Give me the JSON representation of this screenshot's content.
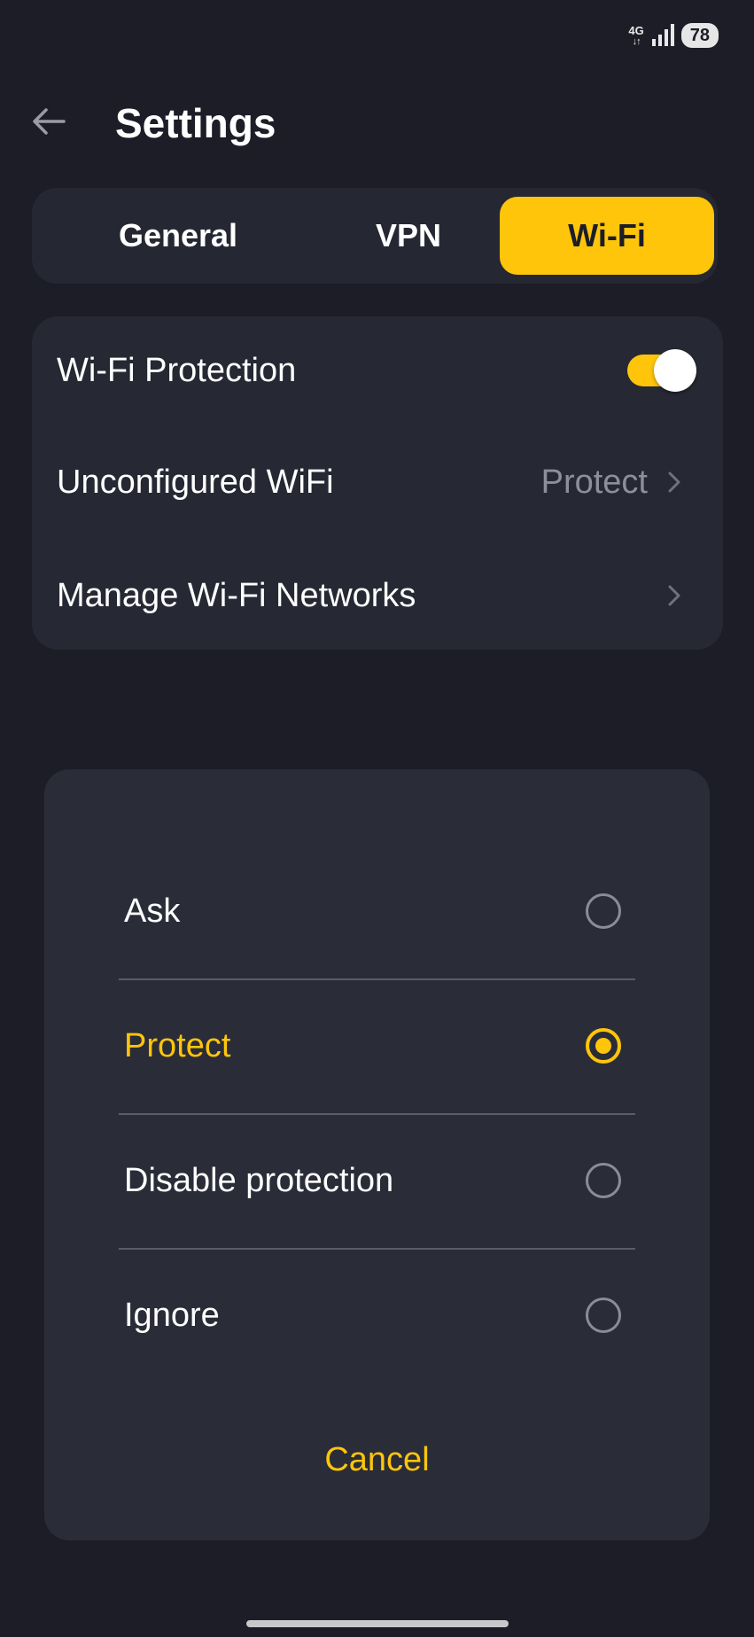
{
  "status_bar": {
    "network": "4G",
    "battery": "78"
  },
  "header": {
    "title": "Settings"
  },
  "tabs": [
    {
      "label": "General",
      "active": false
    },
    {
      "label": "VPN",
      "active": false
    },
    {
      "label": "Wi-Fi",
      "active": true
    }
  ],
  "settings": {
    "wifi_protection": {
      "label": "Wi-Fi Protection",
      "enabled": true
    },
    "unconfigured_wifi": {
      "label": "Unconfigured WiFi",
      "value": "Protect"
    },
    "manage_networks": {
      "label": "Manage Wi-Fi Networks"
    }
  },
  "dialog": {
    "options": [
      {
        "label": "Ask",
        "selected": false
      },
      {
        "label": "Protect",
        "selected": true
      },
      {
        "label": "Disable protection",
        "selected": false
      },
      {
        "label": "Ignore",
        "selected": false
      }
    ],
    "cancel_label": "Cancel"
  },
  "colors": {
    "background": "#1c1d27",
    "card": "#262833",
    "dialog": "#2a2c38",
    "accent": "#fec50b",
    "muted_text": "#8d8e99"
  },
  "icons": {
    "back": "arrow-left-icon",
    "signal": "signal-bars-icon",
    "chevron": "chevron-right-icon"
  }
}
